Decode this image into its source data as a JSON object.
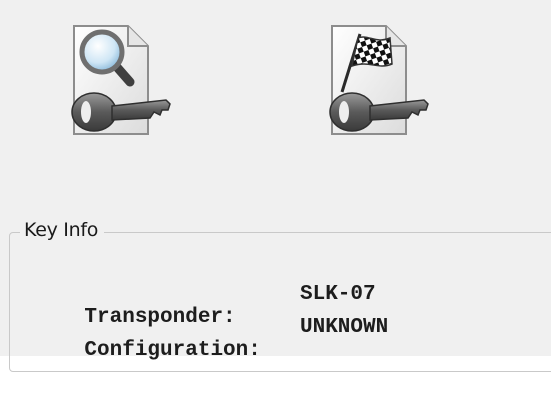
{
  "toolbar": {
    "buttons": [
      {
        "icon": "key-search-icon"
      },
      {
        "icon": "key-checkered-flag-icon"
      }
    ]
  },
  "key_info": {
    "group_title": "Key Info",
    "rows": [
      {
        "label": "Transponder:",
        "value": "SLK-07"
      },
      {
        "label": "Configuration:",
        "value": "UNKNOWN"
      }
    ]
  },
  "colors": {
    "panel_background": "#f0f0f0",
    "group_border": "#c9c9c9",
    "text": "#1d1d1d"
  }
}
